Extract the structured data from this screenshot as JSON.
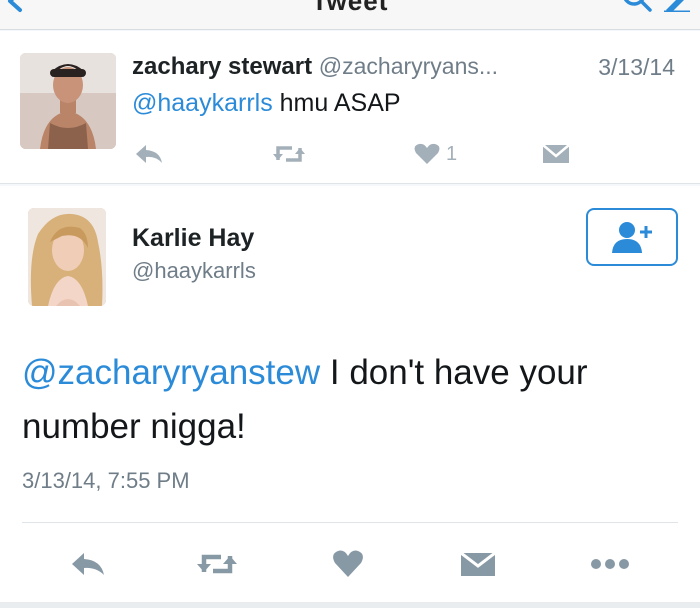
{
  "nav": {
    "title": "Tweet",
    "back_icon": "back-arrow-icon",
    "right_icons": [
      "search-icon",
      "compose-icon"
    ]
  },
  "reply_tweet": {
    "author_name": "zachary stewart",
    "author_handle": "@zacharyryans...",
    "date": "3/13/14",
    "mention": "@haaykarrls",
    "text": " hmu ASAP",
    "like_count": "1",
    "actions": [
      "reply-icon",
      "retweet-icon",
      "like-icon",
      "message-icon"
    ]
  },
  "main_tweet": {
    "author_name": "Karlie Hay",
    "author_handle": "@haaykarrls",
    "mention": "@zacharyryanstew",
    "text": " I don't have your number nigga!",
    "timestamp": "3/13/14, 7:55 PM",
    "follow_icon": "add-user-icon",
    "actions": [
      "reply-icon",
      "retweet-icon",
      "like-icon",
      "message-icon",
      "more-icon"
    ]
  },
  "colors": {
    "link_blue": "#2b8bd8",
    "icon_gray": "#a4b0b9",
    "icon_dark_gray": "#8899a6",
    "secondary_text": "#6f7d88"
  }
}
